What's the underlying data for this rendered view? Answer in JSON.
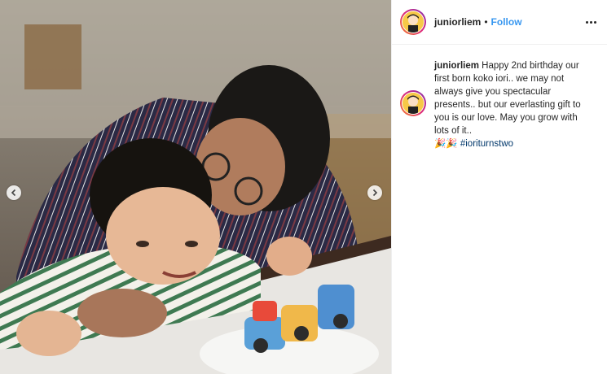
{
  "post": {
    "username": "juniorliem",
    "separator": "•",
    "follow_label": "Follow",
    "caption": {
      "username": "juniorliem",
      "text": "Happy 2nd birthday our first born koko iori.. we may not always give you spectacular presents.. but our everlasting gift to you is our love. May you grow with lots of it..",
      "emojis": "🎉🎉",
      "hashtag": "#ioriturnstwo"
    }
  },
  "icons": {
    "prev": "chevron-left-icon",
    "next": "chevron-right-icon",
    "more": "more-options-icon"
  }
}
